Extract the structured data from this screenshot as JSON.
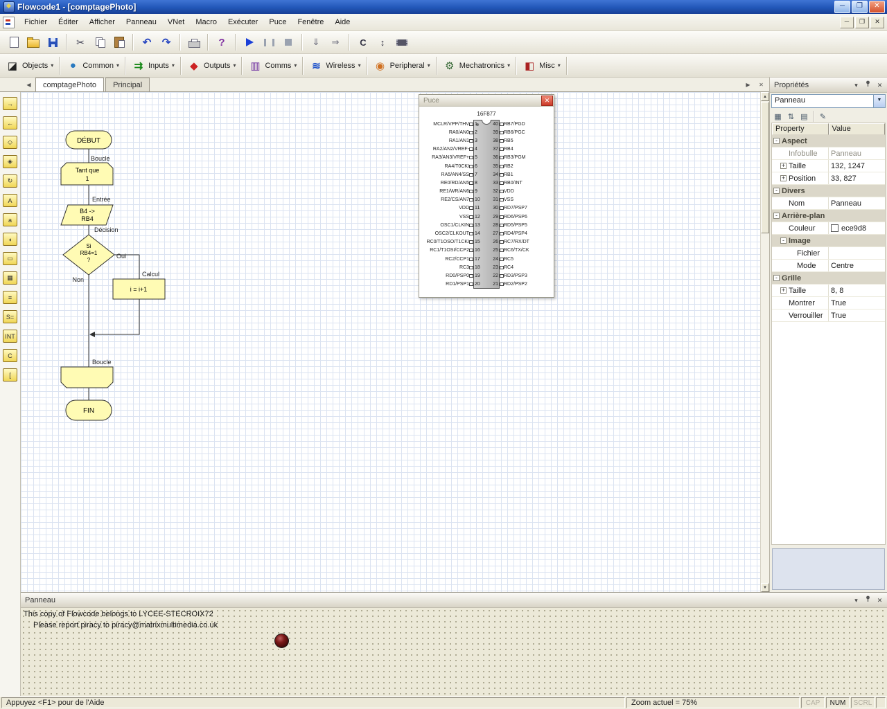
{
  "window": {
    "title": "Flowcode1 - [comptagePhoto]"
  },
  "menu": {
    "items": [
      "Fichier",
      "Éditer",
      "Afficher",
      "Panneau",
      "VNet",
      "Macro",
      "Exécuter",
      "Puce",
      "Fenêtre",
      "Aide"
    ]
  },
  "toolbar": {
    "buttons": [
      "new",
      "open",
      "save",
      "cut",
      "copy",
      "paste",
      "undo",
      "redo",
      "print",
      "help",
      "run",
      "pause",
      "stop",
      "step-into",
      "step-over",
      "compile-c",
      "compile-hex",
      "program-chip"
    ]
  },
  "components": {
    "groups": [
      {
        "label": "Objects",
        "glyph": "◪",
        "style": "color:#222"
      },
      {
        "label": "Common",
        "glyph": "●",
        "style": "color:#2a7ac0"
      },
      {
        "label": "Inputs",
        "glyph": "⇉",
        "style": "color:#1a8a1a;font-weight:bold"
      },
      {
        "label": "Outputs",
        "glyph": "◆",
        "style": "color:#cc2222"
      },
      {
        "label": "Comms",
        "glyph": "▥",
        "style": "color:#7030a0"
      },
      {
        "label": "Wireless",
        "glyph": "≋",
        "style": "color:#2255cc;font-weight:bold"
      },
      {
        "label": "Peripheral",
        "glyph": "◉",
        "style": "color:#d07020"
      },
      {
        "label": "Mechatronics",
        "glyph": "⚙",
        "style": "color:#336633"
      },
      {
        "label": "Misc",
        "glyph": "◧",
        "style": "color:#aa2222"
      }
    ]
  },
  "tabs": {
    "items": [
      {
        "label": "comptagePhoto",
        "cls": "tab active"
      },
      {
        "label": "Principal",
        "cls": "tab"
      }
    ]
  },
  "shape_tools": {
    "items": [
      {
        "name": "input",
        "glyph": "→"
      },
      {
        "name": "output",
        "glyph": "←"
      },
      {
        "name": "decision",
        "glyph": "◇"
      },
      {
        "name": "switch",
        "glyph": "◈"
      },
      {
        "name": "loop",
        "glyph": "↻"
      },
      {
        "name": "macro-call",
        "glyph": "A"
      },
      {
        "name": "macro",
        "glyph": "a"
      },
      {
        "name": "component-macro",
        "glyph": "◖"
      },
      {
        "name": "calculation",
        "glyph": "▭"
      },
      {
        "name": "string",
        "glyph": "▦"
      },
      {
        "name": "comment",
        "glyph": "≡"
      },
      {
        "name": "string-assign",
        "glyph": "S="
      },
      {
        "name": "interrupt",
        "glyph": "INT"
      },
      {
        "name": "c-code",
        "glyph": "C"
      },
      {
        "name": "connection-point",
        "glyph": "["
      }
    ]
  },
  "flowchart": {
    "begin": "DÉBUT",
    "loop_caption": "Boucle",
    "loop_line1": "Tant que",
    "loop_line2": "1",
    "input_caption": "Entrée",
    "input_line1": "B4 ->",
    "input_line2": "RB4",
    "decision_caption": "Décision",
    "decision_line1": "Si",
    "decision_line2": "RB4=1",
    "decision_line3": "?",
    "branch_yes": "Oui",
    "branch_no": "Non",
    "calc_caption": "Calcul",
    "calc_text": "i = i+1",
    "loop_end_caption": "Boucle",
    "end": "FIN"
  },
  "chip_window": {
    "title": "Puce",
    "chip_name": "16F877",
    "pins": [
      {
        "ln": "1",
        "ll": "MCLR/VPP/THV",
        "rn": "40",
        "rl": "RB7/PGD"
      },
      {
        "ln": "2",
        "ll": "RA0/AN0",
        "rn": "39",
        "rl": "RB6/PGC"
      },
      {
        "ln": "3",
        "ll": "RA1/AN1",
        "rn": "38",
        "rl": "RB5"
      },
      {
        "ln": "4",
        "ll": "RA2/AN2/VREF-",
        "rn": "37",
        "rl": "RB4"
      },
      {
        "ln": "5",
        "ll": "RA3/AN3/VREF+",
        "rn": "36",
        "rl": "RB3/PGM"
      },
      {
        "ln": "6",
        "ll": "RA4/T0CKI",
        "rn": "35",
        "rl": "RB2"
      },
      {
        "ln": "7",
        "ll": "RA5/AN4/SS",
        "rn": "34",
        "rl": "RB1"
      },
      {
        "ln": "8",
        "ll": "RE0/RD/AN5",
        "rn": "33",
        "rl": "RB0/INT"
      },
      {
        "ln": "9",
        "ll": "RE1/WR/AN6",
        "rn": "32",
        "rl": "VDD"
      },
      {
        "ln": "10",
        "ll": "RE2/CS/AN7",
        "rn": "31",
        "rl": "VSS"
      },
      {
        "ln": "11",
        "ll": "VDD",
        "rn": "30",
        "rl": "RD7/PSP7"
      },
      {
        "ln": "12",
        "ll": "VSS",
        "rn": "29",
        "rl": "RD6/PSP6"
      },
      {
        "ln": "13",
        "ll": "OSC1/CLKIN",
        "rn": "28",
        "rl": "RD5/PSP5"
      },
      {
        "ln": "14",
        "ll": "OSC2/CLKOUT",
        "rn": "27",
        "rl": "RD4/PSP4"
      },
      {
        "ln": "15",
        "ll": "RC0/T1OSO/T1CKI",
        "rn": "26",
        "rl": "RC7/RX/DT"
      },
      {
        "ln": "16",
        "ll": "RC1/T1OSI/CCP2",
        "rn": "25",
        "rl": "RC6/TX/CK"
      },
      {
        "ln": "17",
        "ll": "RC2/CCP1",
        "rn": "24",
        "rl": "RC5"
      },
      {
        "ln": "18",
        "ll": "RC3",
        "rn": "23",
        "rl": "RC4"
      },
      {
        "ln": "19",
        "ll": "RD0/PSP0",
        "rn": "22",
        "rl": "RD3/PSP3"
      },
      {
        "ln": "20",
        "ll": "RD1/PSP1",
        "rn": "21",
        "rl": "RD2/PSP2"
      }
    ]
  },
  "properties_panel": {
    "title": "Propriétés",
    "selector_value": "Panneau",
    "header": {
      "property": "Property",
      "value": "Value"
    },
    "rows": [
      {
        "cls": "prow cat",
        "box": "minus",
        "label": "Aspect",
        "value": ""
      },
      {
        "cls": "prow p muted",
        "box": "none",
        "label": "Infobulle",
        "value": "Panneau"
      },
      {
        "cls": "prow p",
        "box": "plus",
        "label": "Taille",
        "value": "132, 1247"
      },
      {
        "cls": "prow p",
        "box": "plus",
        "label": "Position",
        "value": "33, 827"
      },
      {
        "cls": "prow cat",
        "box": "minus",
        "label": "Divers",
        "value": ""
      },
      {
        "cls": "prow p",
        "box": "none",
        "label": "Nom",
        "value": "Panneau"
      },
      {
        "cls": "prow cat",
        "box": "minus",
        "label": "Arrière-plan",
        "value": ""
      },
      {
        "cls": "prow p",
        "box": "none",
        "label": "Couleur",
        "value": "ece9d8",
        "swatch_style": "display:inline-block"
      },
      {
        "cls": "prow subcat",
        "box": "minus",
        "label": "Image",
        "value": ""
      },
      {
        "cls": "prow p sub",
        "box": "none",
        "label": "Fichier",
        "value": ""
      },
      {
        "cls": "prow p sub",
        "box": "none",
        "label": "Mode",
        "value": "Centre"
      },
      {
        "cls": "prow cat",
        "box": "minus",
        "label": "Grille",
        "value": ""
      },
      {
        "cls": "prow p",
        "box": "plus",
        "label": "Taille",
        "value": "8, 8"
      },
      {
        "cls": "prow p",
        "box": "none",
        "label": "Montrer",
        "value": "True"
      },
      {
        "cls": "prow p",
        "box": "none",
        "label": "Verrouiller",
        "value": "True"
      }
    ]
  },
  "panel_window": {
    "title": "Panneau",
    "notice_line1": "This copy of Flowcode belongs to LYCEE-STECROIX72",
    "notice_line2": "Please report piracy to piracy@matrixmultimedia.co.uk"
  },
  "status_bar": {
    "help": "Appuyez <F1> pour de l'Aide",
    "zoom": "Zoom actuel = 75%",
    "indicators": [
      {
        "label": "CAP",
        "cls": "sb-ind"
      },
      {
        "label": "NUM",
        "cls": "sb-ind on"
      },
      {
        "label": "SCRL",
        "cls": "sb-ind"
      }
    ]
  },
  "colors": {
    "titlebar_blue": "#2257b8",
    "shape_yellow": "#fffbb4",
    "panel_beige": "#ece9d8",
    "grid_blue": "#dbe3f1",
    "close_red": "#d4502c"
  }
}
